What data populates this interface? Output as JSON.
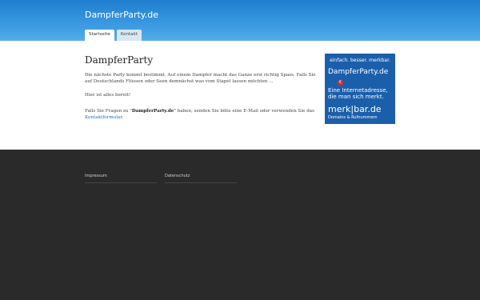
{
  "header": {
    "site_title": "DampferParty.de"
  },
  "nav": {
    "tabs": [
      {
        "label": "Startseite"
      },
      {
        "label": "Kontakt"
      }
    ]
  },
  "main": {
    "title": "DampferParty",
    "p1": "Die nächste Party kommt bestimmt. Auf einem Dampfer macht das Ganze erst richtig Spass. Falls Sie auf Deutschlands Flüssen oder Seen demnächst was vom Stapel lassen möchten ...",
    "p2": "Hier ist alles bereit!",
    "p3_part1": "Falls Sie Fragen zu \"",
    "p3_bold": "DampferParty.de",
    "p3_part2": "\" haben, senden Sie bitte eine E-Mail oder verwenden Sie das ",
    "p3_link": "Kontaktformular",
    "p3_end": "."
  },
  "ad": {
    "tagline": "einfach. besser. merkbar.",
    "domain": "DampferParty.de",
    "badge": "€",
    "text": "Eine Internetadresse, die man sich merkt.",
    "brand": "merk|bar.de",
    "footer": "Domains & Rufnummern"
  },
  "footer": {
    "links": [
      {
        "label": "Impressum"
      },
      {
        "label": "Datenschutz"
      }
    ]
  }
}
